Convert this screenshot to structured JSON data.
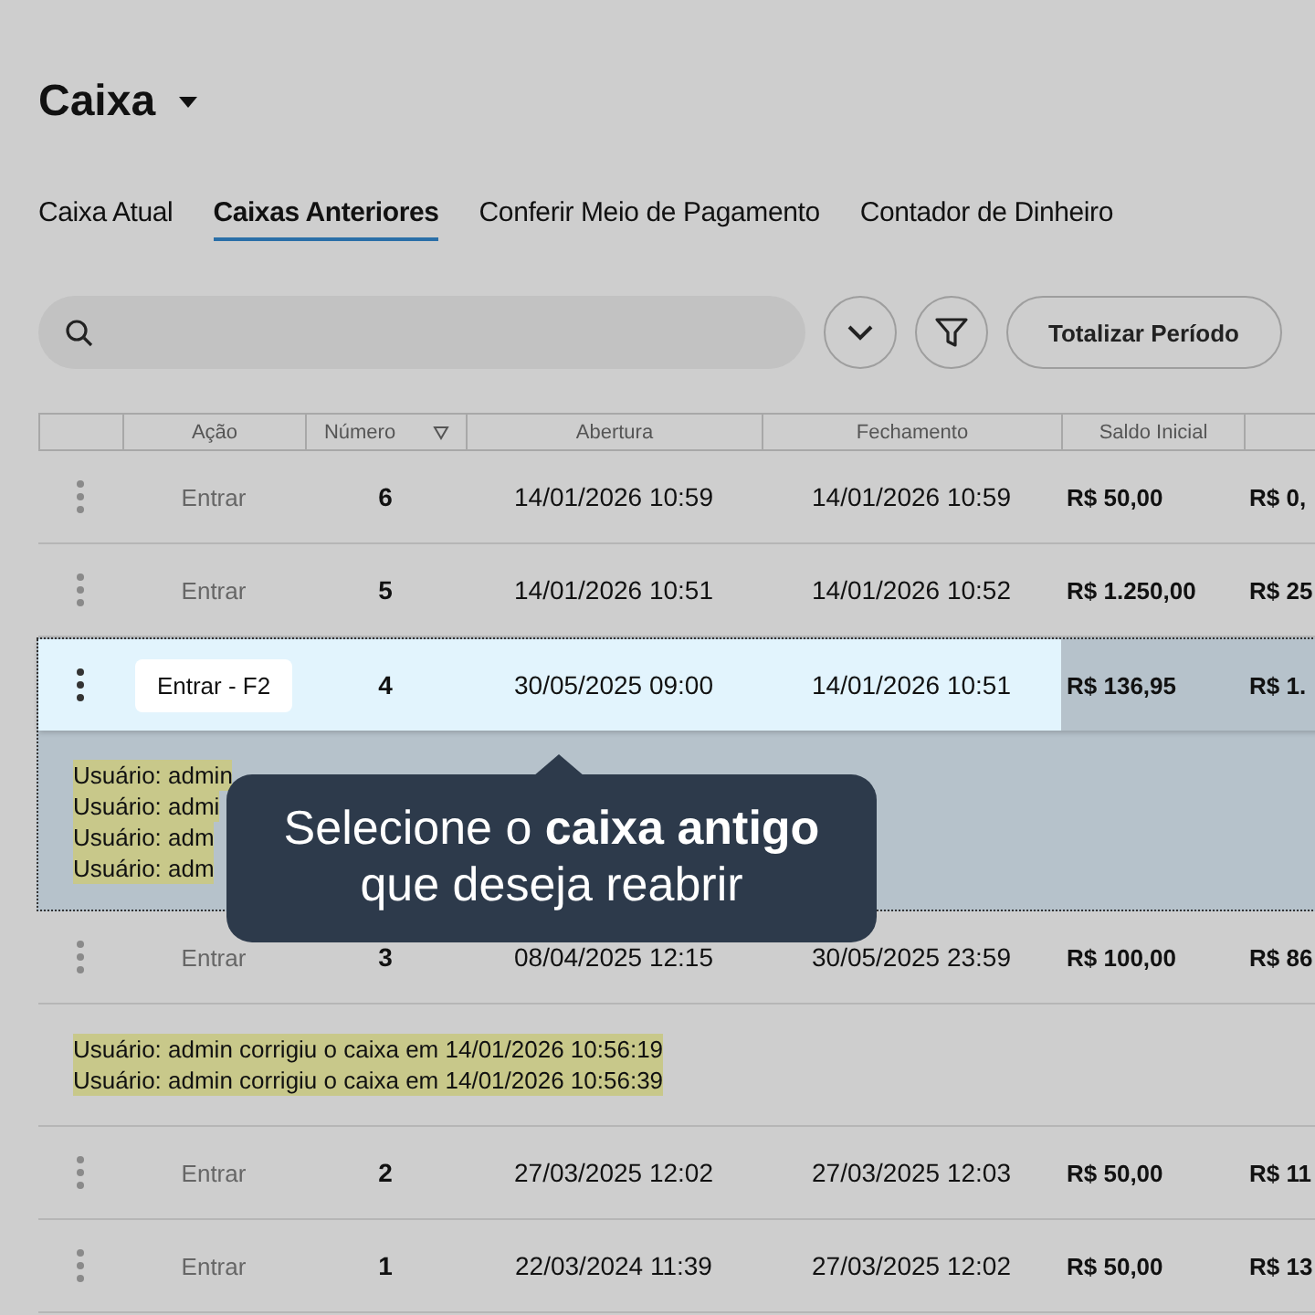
{
  "title": "Caixa",
  "tabs": [
    {
      "label": "Caixa Atual",
      "selected": false
    },
    {
      "label": "Caixas Anteriores",
      "selected": true
    },
    {
      "label": "Conferir Meio de Pagamento",
      "selected": false
    },
    {
      "label": "Contador de Dinheiro",
      "selected": false
    }
  ],
  "toolbar": {
    "total_button": "Totalizar Período"
  },
  "table": {
    "columns": [
      "Ação",
      "Número",
      "Abertura",
      "Fechamento",
      "Saldo Inicial"
    ],
    "rows": [
      {
        "action": "Entrar",
        "number": "6",
        "opening": "14/01/2026 10:59",
        "closing": "14/01/2026 10:59",
        "initial": "R$ 50,00",
        "column_7": "R$ 0,",
        "selected": false,
        "logs": []
      },
      {
        "action": "Entrar",
        "number": "5",
        "opening": "14/01/2026 10:51",
        "closing": "14/01/2026 10:52",
        "initial": "R$ 1.250,00",
        "column_7": "R$ 25",
        "selected": false,
        "logs": []
      },
      {
        "action": "Entrar - F2",
        "number": "4",
        "opening": "30/05/2025 09:00",
        "closing": "14/01/2026 10:51",
        "initial": "R$ 136,95",
        "column_7": "R$ 1.",
        "selected": true,
        "logs": [
          "Usuário: admin",
          "Usuário: admi",
          "Usuário: adm",
          "Usuário: adm"
        ]
      },
      {
        "action": "Entrar",
        "number": "3",
        "opening": "08/04/2025 12:15",
        "closing": "30/05/2025 23:59",
        "initial": "R$ 100,00",
        "column_7": "R$ 86",
        "selected": false,
        "logs": [
          "Usuário: admin corrigiu o caixa em 14/01/2026 10:56:19",
          "Usuário: admin corrigiu o caixa em 14/01/2026 10:56:39"
        ]
      },
      {
        "action": "Entrar",
        "number": "2",
        "opening": "27/03/2025 12:02",
        "closing": "27/03/2025 12:03",
        "initial": "R$ 50,00",
        "column_7": "R$ 11",
        "selected": false,
        "logs": []
      },
      {
        "action": "Entrar",
        "number": "1",
        "opening": "22/03/2024 11:39",
        "closing": "27/03/2025 12:02",
        "initial": "R$ 50,00",
        "column_7": "R$ 13",
        "selected": false,
        "logs": []
      }
    ]
  },
  "tooltip": "Selecione o **caixa antigo**\nque deseja reabrir"
}
